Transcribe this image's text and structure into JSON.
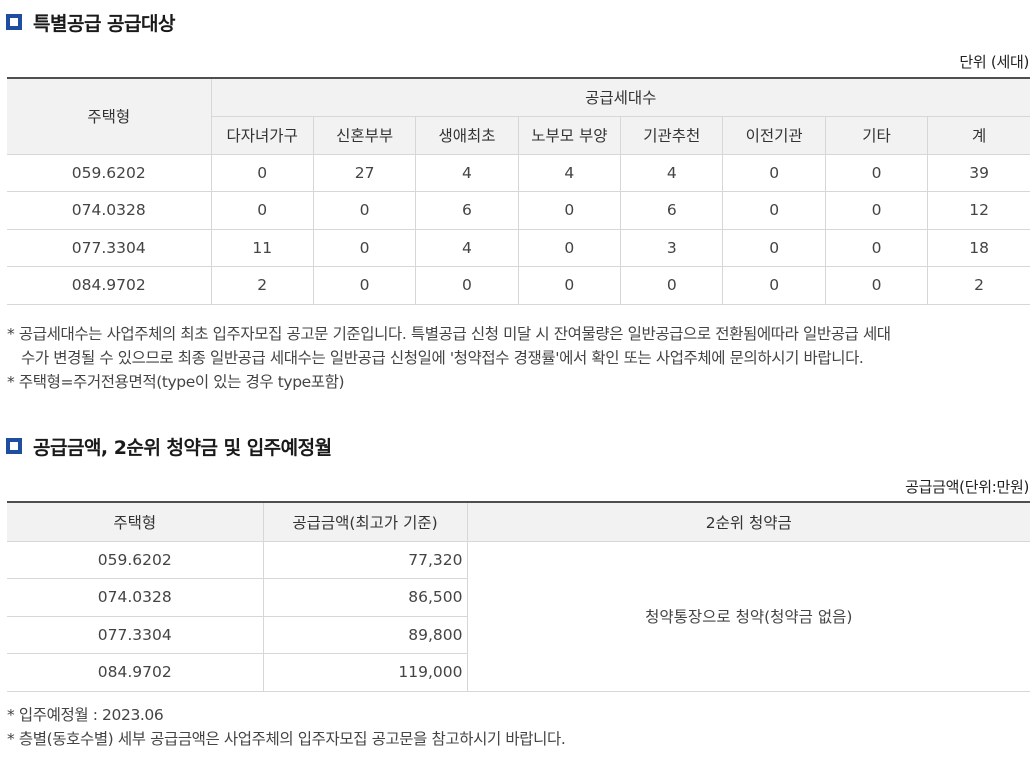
{
  "section1": {
    "title": "특별공급 공급대상",
    "unit": "단위 (세대)",
    "table": {
      "housing_type_header": "주택형",
      "group_header": "공급세대수",
      "columns": [
        "다자녀가구",
        "신혼부부",
        "생애최초",
        "노부모 부양",
        "기관추천",
        "이전기관",
        "기타",
        "계"
      ],
      "rows": [
        {
          "type": "059.6202",
          "values": [
            "0",
            "27",
            "4",
            "4",
            "4",
            "0",
            "0",
            "39"
          ]
        },
        {
          "type": "074.0328",
          "values": [
            "0",
            "0",
            "6",
            "0",
            "6",
            "0",
            "0",
            "12"
          ]
        },
        {
          "type": "077.3304",
          "values": [
            "11",
            "0",
            "4",
            "0",
            "3",
            "0",
            "0",
            "18"
          ]
        },
        {
          "type": "084.9702",
          "values": [
            "2",
            "0",
            "0",
            "0",
            "0",
            "0",
            "0",
            "2"
          ]
        }
      ]
    },
    "notes": [
      "* 공급세대수는 사업주체의 최초 입주자모집 공고문 기준입니다. 특별공급 신청 미달 시 잔여물량은 일반공급으로 전환됨에따라 일반공급 세대",
      "수가 변경될 수 있으므로 최종 일반공급 세대수는 일반공급 신청일에 '청약접수 경쟁률'에서 확인 또는 사업주체에 문의하시기 바랍니다.",
      "* 주택형=주거전용면적(type이 있는 경우 type포함)"
    ]
  },
  "section2": {
    "title": "공급금액, 2순위 청약금 및 입주예정월",
    "unit": "공급금액(단위:만원)",
    "table": {
      "headers": [
        "주택형",
        "공급금액(최고가 기준)",
        "2순위 청약금"
      ],
      "rows": [
        {
          "type": "059.6202",
          "price": "77,320"
        },
        {
          "type": "074.0328",
          "price": "86,500"
        },
        {
          "type": "077.3304",
          "price": "89,800"
        },
        {
          "type": "084.9702",
          "price": "119,000"
        }
      ],
      "deposit_text": "청약통장으로 청약(청약금 없음)"
    },
    "notes": [
      "* 입주예정월 : 2023.06",
      "* 층별(동호수별) 세부 공급금액은 사업주체의 입주자모집 공고문을 참고하시기 바랍니다."
    ]
  },
  "colors": {
    "accent": "#1f4ea0",
    "header_bg": "#f2f2f2",
    "border": "#d7d7d7",
    "top_border": "#4f4f4f"
  }
}
